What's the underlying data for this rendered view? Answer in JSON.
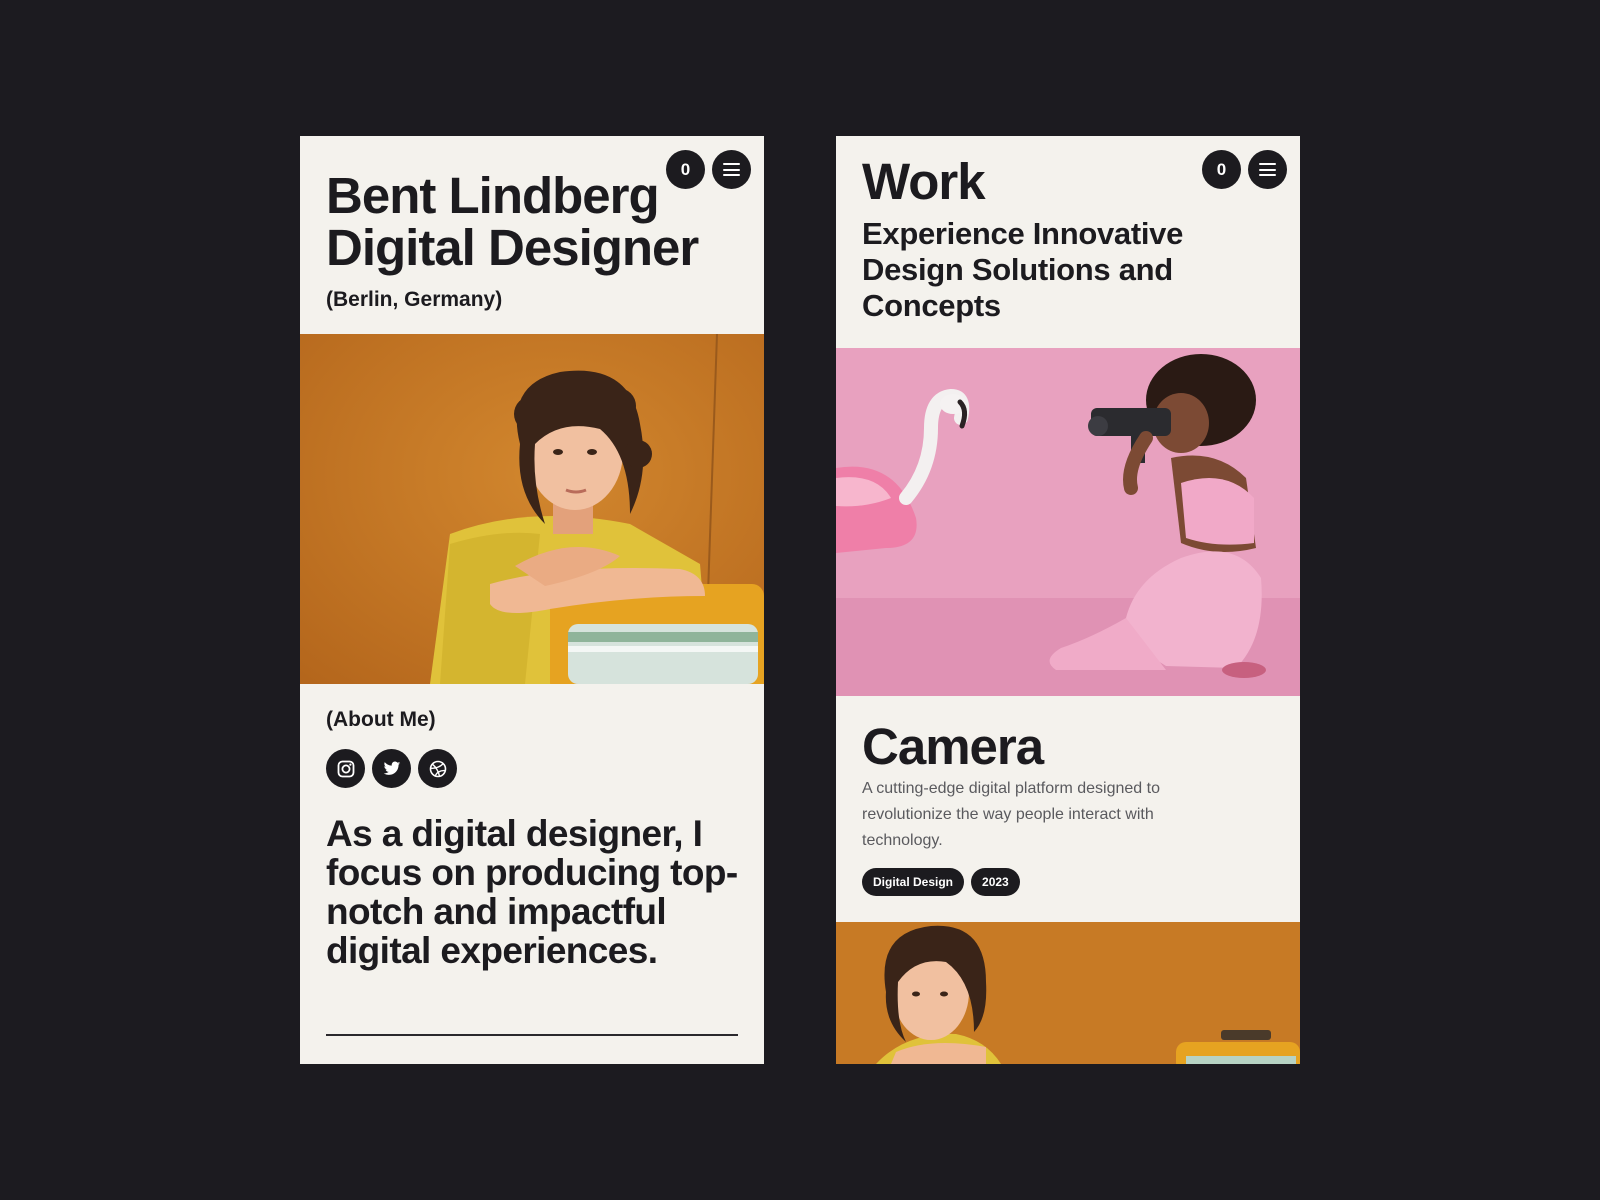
{
  "colors": {
    "canvas_background": "#1c1b20",
    "screen_background": "#f4f2ed",
    "ink": "#1c1b1f",
    "muted_text": "#5a5a5e",
    "accent_orange": "#c9741f",
    "accent_pink": "#e9a3c0"
  },
  "left_screen": {
    "counter": "0",
    "menu_icon": "hamburger-menu-icon",
    "title_line1": "Bent Lindberg",
    "title_line2": "Digital Designer",
    "location": "(Berlin, Germany)",
    "photo": "portrait-curly-hair-yellow-shirt-retro-tv",
    "about_label": "(About Me)",
    "social_icons": [
      "instagram-icon",
      "twitter-icon",
      "dribbble-icon"
    ],
    "about_text": "As a digital designer, I focus on producing top-notch and impactful digital experiences."
  },
  "right_screen": {
    "counter": "0",
    "menu_icon": "hamburger-menu-icon",
    "title": "Work",
    "subtitle": "Experience Innovative Design Solutions and Concepts",
    "project_photo": "woman-with-film-camera-and-flamingo-pink",
    "project_title": "Camera",
    "project_description": "A cutting-edge digital platform designed to revolutionize the way people interact with technology.",
    "tags": [
      "Digital Design",
      "2023"
    ],
    "next_photo": "portrait-curly-hair-yellow-shirt-retro-tv"
  }
}
